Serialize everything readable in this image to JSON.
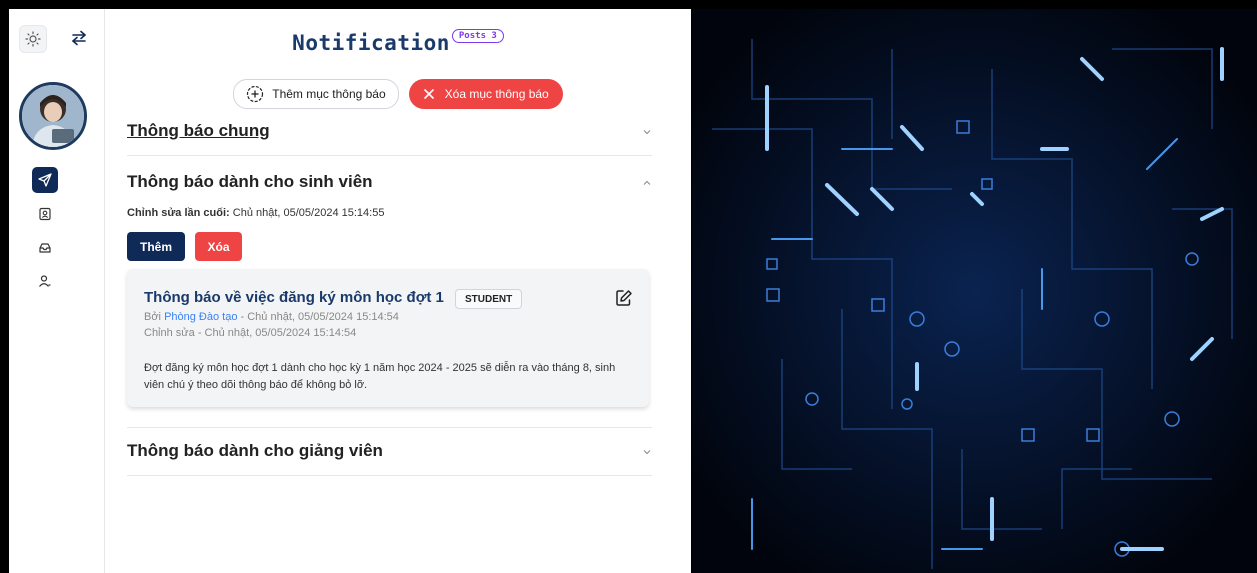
{
  "header": {
    "title": "Notification",
    "posts_badge": "Posts 3"
  },
  "actions": {
    "add_section_label": "Thêm mục thông báo",
    "delete_section_label": "Xóa mục thông báo"
  },
  "sections": [
    {
      "title": "Thông báo chung",
      "expanded": false
    },
    {
      "title": "Thông báo dành cho sinh viên",
      "expanded": true
    },
    {
      "title": "Thông báo dành cho giảng viên",
      "expanded": false
    }
  ],
  "student_section": {
    "last_edit_label": "Chỉnh sửa lần cuối:",
    "last_edit_value": " Chủ nhật, 05/05/2024 15:14:55",
    "add_label": "Thêm",
    "delete_label": "Xóa"
  },
  "post": {
    "title": "Thông báo về việc đăng ký môn học đợt 1",
    "role_badge": "STUDENT",
    "by_prefix": "Bởi ",
    "author": "Phòng Đào tạo",
    "created": " - Chủ nhật, 05/05/2024 15:14:54",
    "edited": "Chỉnh sửa - Chủ nhật, 05/05/2024 15:14:54",
    "body": "Đợt đăng ký môn học đợt 1 dành cho học kỳ 1 năm học 2024 - 2025 sẽ diễn ra vào tháng 8, sinh viên chú ý theo dõi thông báo để không bỏ lỡ."
  },
  "sidebar": {
    "icons": [
      "sun-icon",
      "swap-icon",
      "avatar",
      "send-icon",
      "contact-card-icon",
      "inbox-icon",
      "user-icon"
    ]
  },
  "colors": {
    "primary": "#0f2a57",
    "danger": "#ef4444",
    "title": "#1a3a6b",
    "badge": "#7c3aed",
    "link": "#3b82f6"
  }
}
